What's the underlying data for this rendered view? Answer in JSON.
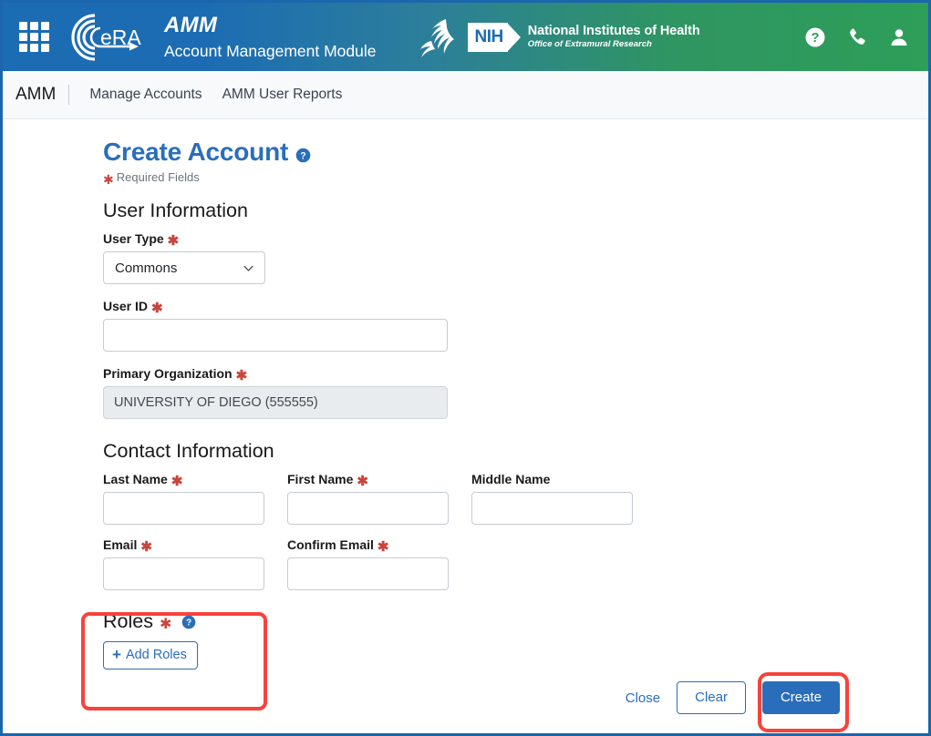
{
  "header": {
    "grid_icon": "app-grid-icon",
    "era_logo_text": "eRA",
    "app_abbr": "AMM",
    "app_fullname": "Account Management Module",
    "hhs_logo": "hhs-seal-icon",
    "nih_badge": "NIH",
    "nih_line1": "National Institutes of Health",
    "nih_line2": "Office of Extramural Research",
    "actions": [
      {
        "name": "help-icon",
        "label": "Help"
      },
      {
        "name": "phone-icon",
        "label": "Contact"
      },
      {
        "name": "user-icon",
        "label": "Account"
      }
    ]
  },
  "nav": {
    "brand": "AMM",
    "items": [
      {
        "label": "Manage Accounts"
      },
      {
        "label": "AMM User Reports"
      }
    ]
  },
  "main": {
    "title": "Create Account",
    "title_help_icon": "help-circle-icon",
    "required_note": "Required Fields",
    "required_marker": "✱",
    "sections": {
      "user_information": {
        "heading": "User Information",
        "user_type": {
          "label": "User Type",
          "required": true,
          "value": "Commons",
          "chevron_icon": "chevron-down-icon"
        },
        "user_id": {
          "label": "User ID",
          "required": true,
          "value": "",
          "placeholder": ""
        },
        "primary_organization": {
          "label": "Primary Organization",
          "required": true,
          "value": "UNIVERSITY OF DIEGO (555555)",
          "readonly": true
        }
      },
      "contact_information": {
        "heading": "Contact Information",
        "fields": [
          {
            "label": "Last Name",
            "required": true,
            "value": "",
            "placeholder": ""
          },
          {
            "label": "First Name",
            "required": true,
            "value": "",
            "placeholder": ""
          },
          {
            "label": "Middle Name",
            "required": false,
            "value": "",
            "placeholder": ""
          },
          {
            "label": "Email",
            "required": true,
            "value": "",
            "placeholder": ""
          },
          {
            "label": "Confirm Email",
            "required": true,
            "value": "",
            "placeholder": ""
          }
        ]
      },
      "roles": {
        "heading": "Roles",
        "required": true,
        "help_icon": "help-circle-icon",
        "add_button_label": "Add Roles",
        "add_button_plus": "+"
      }
    },
    "actions": {
      "close_label": "Close",
      "clear_label": "Clear",
      "create_label": "Create"
    },
    "annotations": [
      {
        "name": "roles-highlight",
        "color": "#f8423c"
      },
      {
        "name": "create-button-highlight",
        "color": "#f8423c"
      }
    ]
  },
  "colors": {
    "header_gradient_start": "#1c6cb3",
    "header_gradient_end": "#2e9e58",
    "brand_blue": "#2a6ebb",
    "required_red": "#c9453d",
    "annotation_red": "#f8423c",
    "readonly_bg": "#e9ecef",
    "nav_bg": "#f7f9fb",
    "page_border": "#1b66ad"
  }
}
